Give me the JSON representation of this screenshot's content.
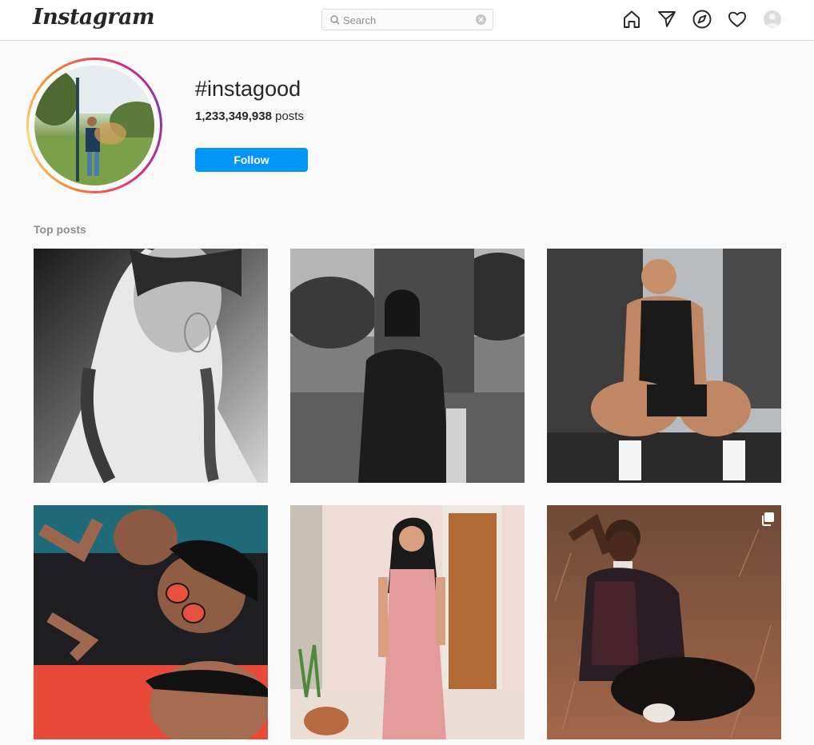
{
  "topbar": {
    "logo": "Instagram",
    "search_placeholder": "Search",
    "nav_icons": [
      "home-icon",
      "direct-icon",
      "explore-icon",
      "activity-icon",
      "profile-avatar"
    ]
  },
  "tag": {
    "name": "#instagood",
    "posts_count": "1,233,349,938",
    "posts_label": "posts",
    "follow_label": "Follow"
  },
  "section": {
    "top_posts_label": "Top posts"
  },
  "colors": {
    "accent": "#0095f6",
    "ring_gradient": [
      "#f58529",
      "#dd2a7b",
      "#8134af"
    ],
    "border": "#dbdbdb",
    "secondary_text": "#8e8e8e"
  },
  "posts": [
    {
      "name": "post-1",
      "subject": "black-and-white portrait of woman with braids and hoop earrings",
      "multi": false
    },
    {
      "name": "post-2",
      "subject": "black-and-white woman standing by tree trunk",
      "multi": false
    },
    {
      "name": "post-3",
      "subject": "muscular man in black tank top sitting in gym",
      "multi": false
    },
    {
      "name": "post-4",
      "subject": "group selfie of three young men, one with red sunglasses",
      "multi": false
    },
    {
      "name": "post-5",
      "subject": "woman in pink dress posing by wooden door",
      "multi": false
    },
    {
      "name": "post-6",
      "subject": "woman in plaid jacket sitting in dry grass field",
      "multi": true
    }
  ]
}
